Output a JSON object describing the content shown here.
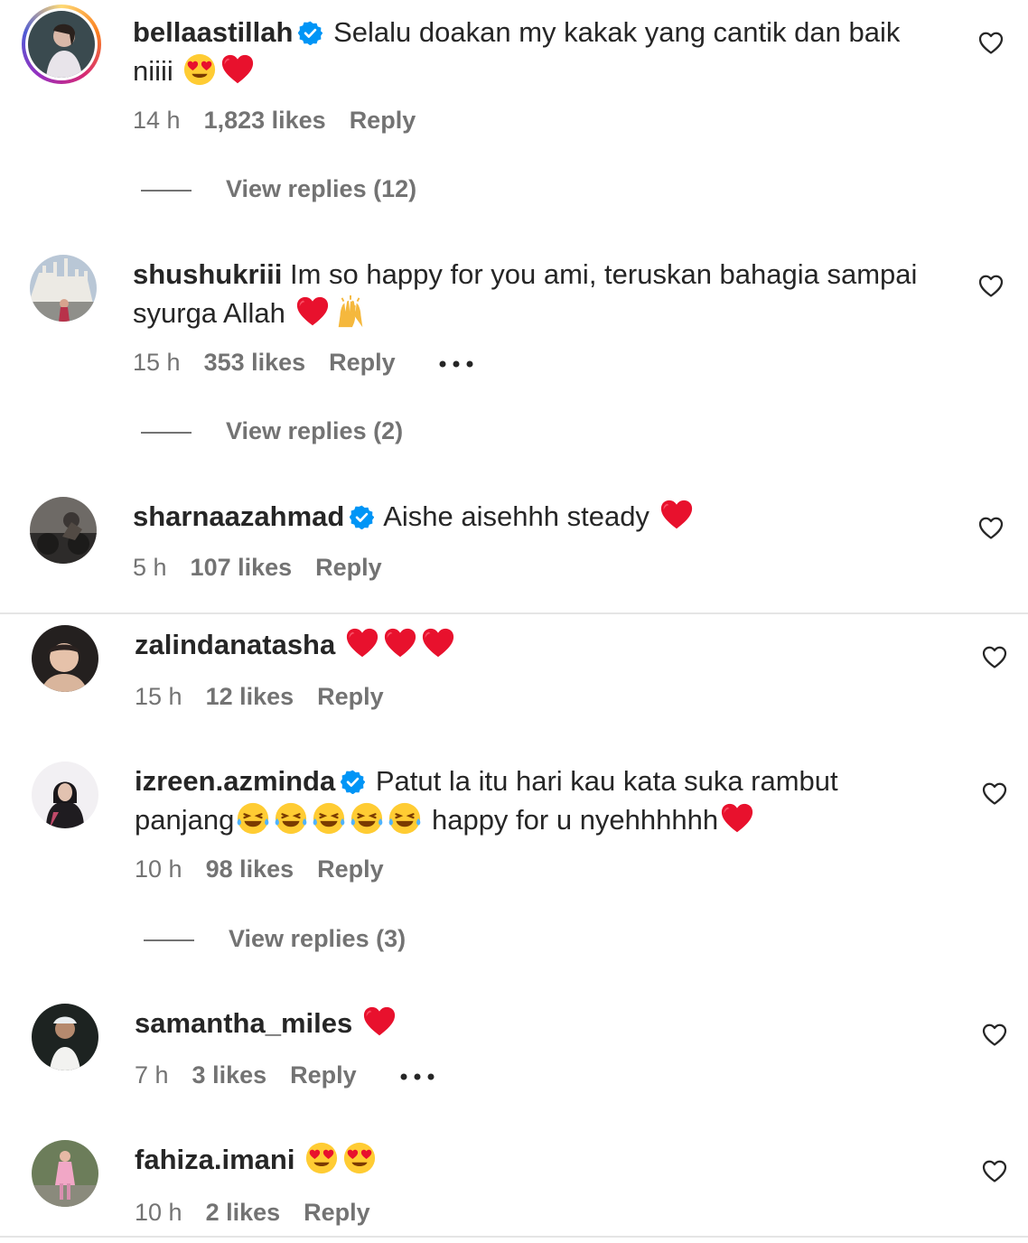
{
  "comments": [
    {
      "user": "bellaastillah",
      "text": "Selalu doakan my kakak yang cantik dan baik niiii",
      "time": "14 h",
      "likes": "1,823 likes",
      "reply": "Reply",
      "view_replies": "View replies (12)"
    },
    {
      "user": "shushukriii",
      "text": "Im so happy for you ami, teruskan bahagia sampai syurga Allah",
      "time": "15 h",
      "likes": "353 likes",
      "reply": "Reply",
      "view_replies": "View replies (2)"
    },
    {
      "user": "sharnaazahmad",
      "text": "Aishe aisehhh steady",
      "time": "5 h",
      "likes": "107 likes",
      "reply": "Reply"
    },
    {
      "user": "zalindanatasha",
      "text": "",
      "time": "15 h",
      "likes": "12 likes",
      "reply": "Reply"
    },
    {
      "user": "izreen.azminda",
      "text": "Patut la itu hari kau kata suka rambut",
      "text2": "panjang",
      "text3": "happy for u nyehhhhhh",
      "time": "10 h",
      "likes": "98 likes",
      "reply": "Reply",
      "view_replies": "View replies (3)"
    },
    {
      "user": "samantha_miles",
      "text": "",
      "time": "7 h",
      "likes": "3 likes",
      "reply": "Reply"
    },
    {
      "user": "fahiza.imani",
      "text": "",
      "time": "10 h",
      "likes": "2 likes",
      "reply": "Reply"
    }
  ],
  "icons": {
    "heart": "heart-outline-icon",
    "verified": "verified-badge-icon",
    "more": "more-options-icon"
  },
  "colors": {
    "verified": "#0095f6",
    "heart_emoji": "#e8112d",
    "meta_text": "#737373"
  }
}
